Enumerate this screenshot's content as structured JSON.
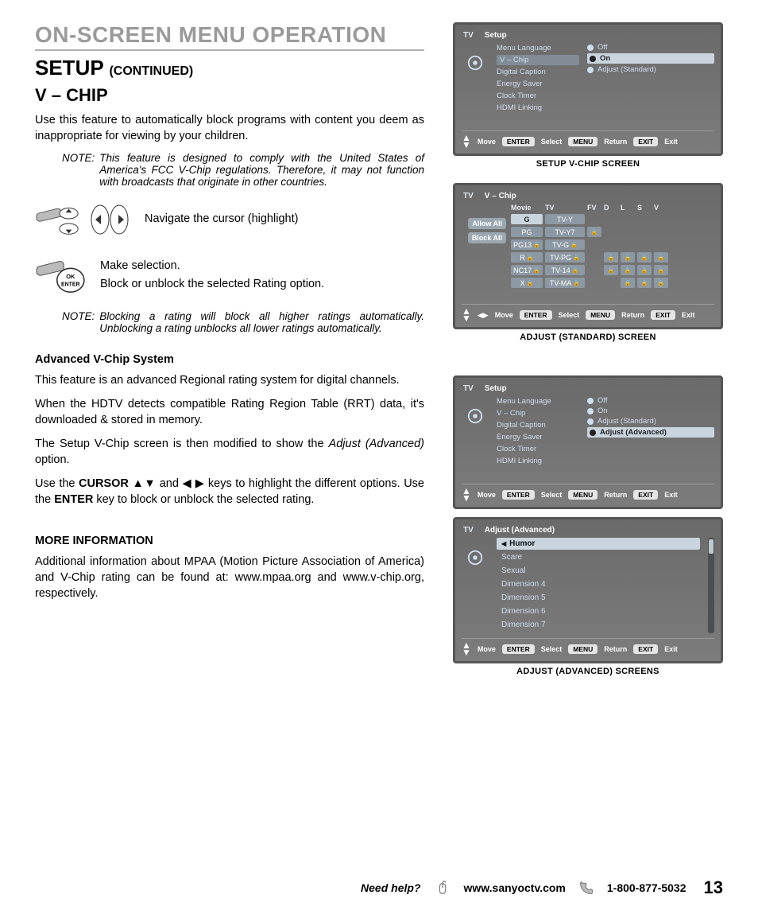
{
  "section_header": "ON-SCREEN MENU OPERATION",
  "setup_title": "SETUP",
  "setup_cont": "(CONTINUED)",
  "vchip_title": "V – CHIP",
  "intro_p": "Use this feature to automatically block programs with content you deem as inappropriate for viewing by your children.",
  "note1_label": "NOTE:",
  "note1_body": "This feature is designed to comply with the United States of America's FCC V-Chip regulations. Therefore, it may not function with broadcasts that originate in other countries.",
  "nav_text": "Navigate the cursor (highlight)",
  "make_sel": "Make selection.",
  "block_unblock": "Block or unblock the selected Rating option.",
  "note2_label": "NOTE:",
  "note2_body": "Blocking a rating will block all higher ratings automatically. Unblocking a rating unblocks all lower ratings automatically.",
  "adv_title": "Advanced V-Chip System",
  "adv_p1": "This feature is an advanced Regional rating system for digital channels.",
  "adv_p2": "When the HDTV detects compatible Rating Region Table (RRT) data, it's downloaded & stored in memory.",
  "adv_p3_a": "The Setup V-Chip screen is then modified to show the ",
  "adv_p3_i": "Adjust (Advanced)",
  "adv_p3_b": " option.",
  "adv_p4_a": "Use the ",
  "adv_p4_cursor": "CURSOR",
  "adv_p4_b": " ▲▼ and ◀ ▶ keys to highlight the different options. Use the ",
  "adv_p4_enter": "ENTER",
  "adv_p4_c": " key to block or unblock the selected rating.",
  "more_title": "MORE INFORMATION",
  "more_p": "Additional information about MPAA (Motion Picture Association of America) and V-Chip rating can be found at: www.mpaa.org and www.v-chip.org, respectively.",
  "osd1": {
    "tv": "TV",
    "screen": "Setup",
    "menu": [
      "Menu Language",
      "V – Chip",
      "Digital Caption",
      "Energy Saver",
      "Clock Timer",
      "HDMI Linking"
    ],
    "options": [
      "Off",
      "On",
      "Adjust (Standard)"
    ],
    "sel_index": 1,
    "bar": {
      "move": "Move",
      "enter": "ENTER",
      "select": "Select",
      "menu": "MENU",
      "return": "Return",
      "exit": "EXIT",
      "exitlbl": "Exit"
    },
    "caption": "SETUP V-CHIP SCREEN"
  },
  "osd2": {
    "tv": "TV",
    "screen": "V – Chip",
    "left_btns": [
      "Allow All",
      "Block All"
    ],
    "hdr": [
      "Movie",
      "TV",
      "FV",
      "D",
      "L",
      "S",
      "V"
    ],
    "rows": [
      [
        "G",
        "TV-Y",
        "",
        "",
        "",
        "",
        ""
      ],
      [
        "PG",
        "TV-Y7",
        "fv",
        "",
        "",
        "",
        ""
      ],
      [
        "PG13",
        "TV-G",
        "",
        "",
        "",
        "",
        ""
      ],
      [
        "R",
        "TV-PG",
        "",
        "d",
        "l",
        "s",
        "v"
      ],
      [
        "NC17",
        "TV-14",
        "",
        "d",
        "l",
        "s",
        "v"
      ],
      [
        "X",
        "TV-MA",
        "",
        "",
        "l",
        "s",
        "v"
      ]
    ],
    "caption": "ADJUST (STANDARD) SCREEN"
  },
  "osd3": {
    "tv": "TV",
    "screen": "Setup",
    "menu": [
      "Menu Language",
      "V – Chip",
      "Digital Caption",
      "Energy Saver",
      "Clock Timer",
      "HDMI Linking"
    ],
    "options": [
      "Off",
      "On",
      "Adjust (Standard)",
      "Adjust (Advanced)"
    ],
    "sel_index": 3
  },
  "osd4": {
    "tv": "TV",
    "screen": "Adjust (Advanced)",
    "items": [
      "Humor",
      "Scare",
      "Sexual",
      "Dimension 4",
      "Dimension 5",
      "Dimension 6",
      "Dimension 7"
    ],
    "sel_index": 0,
    "caption": "ADJUST (ADVANCED) SCREENS"
  },
  "footer": {
    "need": "Need help?",
    "web": "www.sanyoctv.com",
    "phone": "1-800-877-5032",
    "page": "13"
  }
}
